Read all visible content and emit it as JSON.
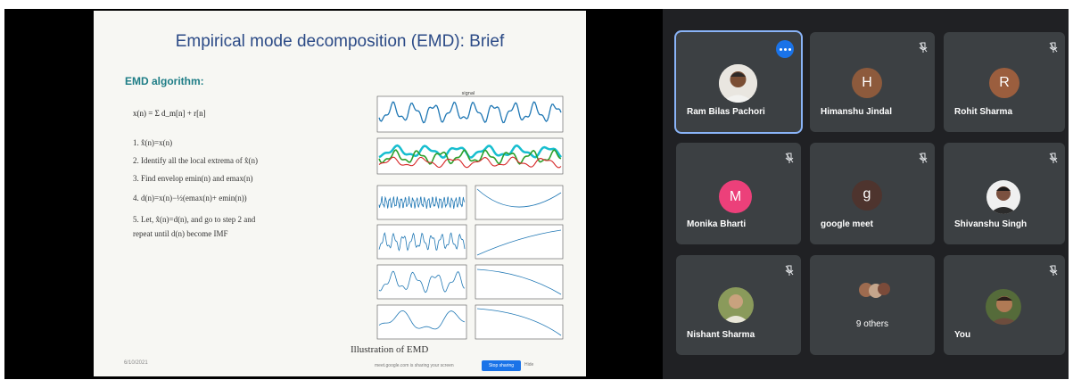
{
  "slide": {
    "title": "Empirical mode decomposition (EMD): Brief",
    "heading": "EMD algorithm:",
    "equation": "x(n) = Σ d_m[n] + r[n]",
    "steps": [
      "1. x̂(n)=x(n)",
      "2. Identify all the local extrema of x̂(n)",
      "3. Find envelop emin(n) and emax(n)",
      "4. d(n)=x(n)−½(emax(n)+ emin(n))",
      "5. Let, x̂(n)=d(n), and go to step 2 and",
      "repeat until d(n) become IMF"
    ],
    "caption": "Illustration of EMD",
    "footer": "6/10/2021",
    "plot_title": "signal",
    "share_text": "meet.google.com is sharing your screen",
    "share_button": "Stop sharing",
    "share_hide": "Hide"
  },
  "participants": [
    {
      "name": "Ram Bilas Pachori",
      "avatar": "photo",
      "state": "speaking"
    },
    {
      "name": "Himanshu Jindal",
      "initial": "H",
      "color": "#8d5a3c",
      "state": "muted"
    },
    {
      "name": "Rohit Sharma",
      "initial": "R",
      "color": "#9b5e3e",
      "state": "muted"
    },
    {
      "name": "Monika Bharti",
      "initial": "M",
      "color": "#ec407a",
      "state": "muted"
    },
    {
      "name": "google meet",
      "initial": "g",
      "color": "#4e342e",
      "state": "muted"
    },
    {
      "name": "Shivanshu Singh",
      "avatar": "photo",
      "state": "muted"
    },
    {
      "name": "Nishant Sharma",
      "avatar": "photo",
      "state": "muted"
    },
    {
      "name": "9 others",
      "avatar": "group",
      "state": "none"
    },
    {
      "name": "You",
      "avatar": "photo",
      "state": "muted"
    }
  ],
  "icons": {
    "mic_off": "mic-off-icon",
    "more": "more-options-icon"
  }
}
